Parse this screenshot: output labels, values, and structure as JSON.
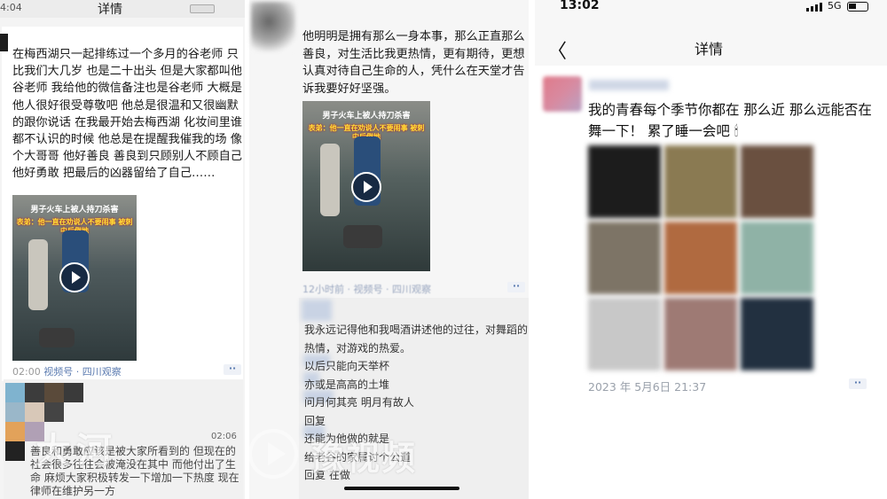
{
  "panel1": {
    "status_time": "4:04",
    "title": "详情",
    "post_text": "在梅西湖只一起排练过一个多月的谷老师 只比我们大几岁 也是二十出头 但是大家都叫他谷老师 我给他的微信备注也是谷老师 大概是他人很好很受尊敬吧 他总是很温和又很幽默的跟你说话 在我最开始去梅西湖 化妆间里谁都不认识的时候 他总是在提醒我催我的场 像个大哥哥 他好善良 善良到只顾别人不顾自己 他好勇敢 把最后的凶器留给了自己……",
    "video_banner": "男子火车上被人持刀杀害",
    "video_caption": "表弟：他一直在劝说人不要闹事 被刺中后倒地",
    "video_time": "02:00",
    "video_source": "视频号 · 四川观察",
    "comment_time": "02:06",
    "comment_text": "善良和勇敢应该是被大家所看到的 但现在的社会很多往往会被淹没在其中 而他付出了生命 麻烦大家积极转发一下增加一下热度 现在律师在维护另一方",
    "more_label": "··"
  },
  "panel2": {
    "post_text": "他明明是拥有那么一身本事，那么正直那么善良，对生活比我更热情，更有期待，更想认真对待自己生命的人，凭什么在天堂才告诉我要好好坚强。",
    "video_banner": "男子火车上被人持刀杀害",
    "video_caption": "表弟：他一直在劝说人不要闹事 被刺中后倒地",
    "meta": "12小时前 · 视频号 · 四川观察",
    "comment_lines": "我永远记得他和我喝酒讲述他的过往，对舞蹈的热情，对游戏的热爱。\n以后只能向天举杯\n亦或是高高的土堆\n问月何其亮  明月有故人\n回复\n还能为他做的就是\n给老谷的家属讨个公道\n回复        在做",
    "more_label": "··"
  },
  "panel3": {
    "status_time": "13:02",
    "network": "5G",
    "title": "详情",
    "back_label": "〈",
    "post_text": "我的青春每个季节你都在  那么近 那么远能否在舞一下！ 累了睡一会吧  🕯",
    "date": "2023 年 5月6日 21:37",
    "more_label": "··"
  },
  "watermark": {
    "brand": "豫视频",
    "logo_text": "大河"
  },
  "colors": {
    "link_blue": "#5b7bb0",
    "date_gray": "#9aa1ab",
    "panel_bg": "#f7f7f7"
  }
}
